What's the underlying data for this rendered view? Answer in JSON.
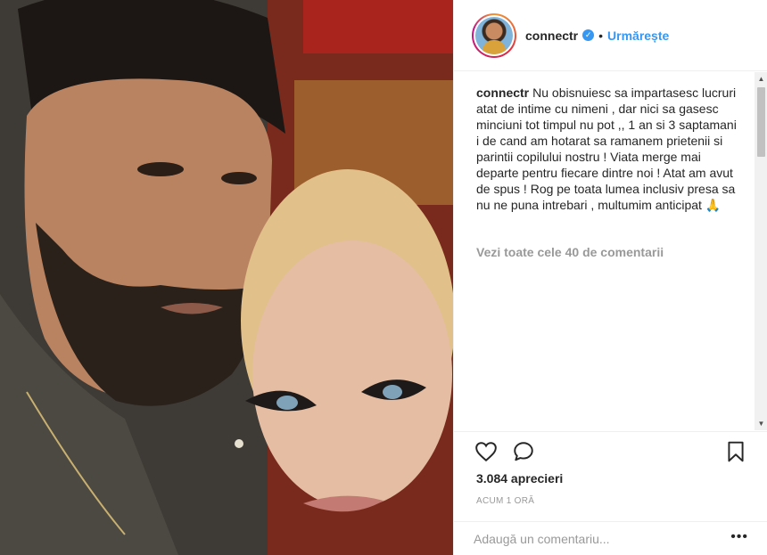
{
  "post": {
    "username": "connectr",
    "verified_badge": "✓",
    "separator": "•",
    "follow_label": "Urmărește",
    "caption": "Nu obisnuiesc sa impartasesc lucruri atat de intime cu nimeni , dar nici sa gasesc minciuni tot timpul nu pot ,, 1 an si 3 saptamani i de cand am hotarat sa ramanem prietenii si parintii copilului nostru ! Viata merge mai departe pentru fiecare dintre noi ! Atat am avut de spus ! Rog pe toata lumea inclusiv presa sa nu ne puna intrebari , multumim anticipat 🙏",
    "view_all_comments": "Vezi toate cele 40 de comentarii",
    "likes": "3.084 aprecieri",
    "time_ago": "ACUM 1 ORĂ"
  },
  "comment_box": {
    "placeholder": "Adaugă un comentariu...",
    "more_label": "•••"
  },
  "scrollbar": {
    "up": "▲",
    "down": "▼"
  },
  "icons": {
    "like": "heart-icon",
    "comment": "comment-bubble-icon",
    "save": "bookmark-icon"
  },
  "colors": {
    "link_blue": "#3897f0",
    "text": "#262626",
    "muted": "#999999",
    "border": "#efefef"
  }
}
